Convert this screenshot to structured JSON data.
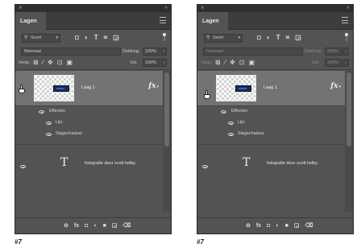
{
  "panels": [
    {
      "title": "Lagen",
      "filter_label": "Soort",
      "filter_icons": [
        "◘",
        "◐",
        "T",
        "⌗",
        "◲"
      ],
      "blend_mode": "Normaal",
      "opacity_label": "Dekking:",
      "opacity_value": "100%",
      "lock_label": "Vergr.:",
      "lock_icons": [
        "⊠",
        "⁄",
        "✥",
        "⊡",
        "▣"
      ],
      "fill_label": "Vul:",
      "fill_value": "100%",
      "layer_name": "Laag 1",
      "fx_label": "fx",
      "effects_label": "Effecten",
      "effect_items": [
        "Lijn",
        "Slagschaduw"
      ],
      "text_layer_glyph": "T",
      "text_layer_name": "fotografie door scott kelby",
      "bottom_icons": [
        "⊖",
        "fx",
        "◘",
        "◐",
        "■",
        "◲",
        "⌫"
      ],
      "cursor": "hand-cursor-pressing"
    },
    {
      "title": "Lagen",
      "filter_label": "Soort",
      "filter_icons": [
        "◘",
        "◐",
        "T",
        "⌗",
        "◲"
      ],
      "blend_mode": "Normaal",
      "opacity_label": "Dekking:",
      "opacity_value": "100%",
      "lock_label": "Vergr.:",
      "lock_icons": [
        "⊠",
        "⁄",
        "✥",
        "⊡",
        "▣"
      ],
      "fill_label": "Vul:",
      "fill_value": "100%",
      "layer_name": "Laag 1",
      "fx_label": "fx",
      "effects_label": "Effecten",
      "effect_items": [
        "Lijn",
        "Slagschaduw"
      ],
      "text_layer_glyph": "T",
      "text_layer_name": "fotografie door scott kelby",
      "bottom_icons": [
        "⊖",
        "fx",
        "◘",
        "◐",
        "■",
        "◲",
        "⌫"
      ],
      "cursor": "hand-cursor-hover"
    }
  ],
  "captions": [
    "#7",
    "#7"
  ],
  "colors": {
    "panel_bg": "#535353",
    "selected_layer": "#737373",
    "dark_bar": "#2f2f2f",
    "layer_accent": "#2f5bd8"
  }
}
